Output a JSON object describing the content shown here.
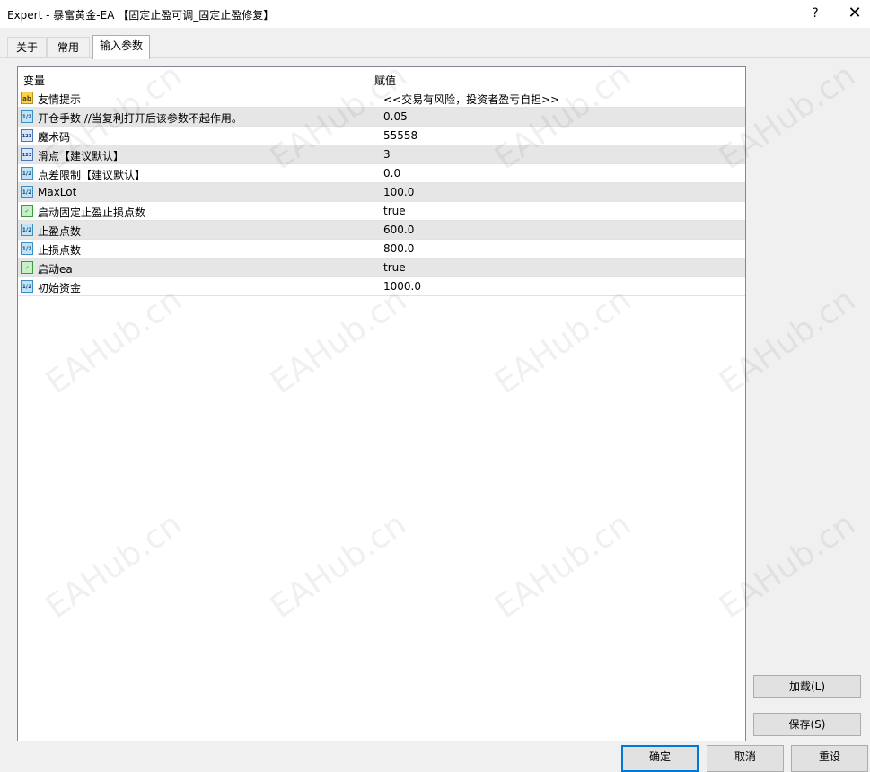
{
  "window": {
    "title": "Expert - 暴富黄金-EA 【固定止盈可调_固定止盈修复】",
    "help_glyph": "?",
    "close_glyph": "✕"
  },
  "tabs": [
    {
      "label": "关于"
    },
    {
      "label": "常用"
    },
    {
      "label": "输入参数"
    }
  ],
  "grid": {
    "header_variable": "变量",
    "header_value": "赋值",
    "rows": [
      {
        "icon": "ab",
        "icon_text": "ab",
        "name": "友情提示",
        "value": "<<交易有风险，投资者盈亏自担>>"
      },
      {
        "icon": "dbl",
        "icon_text": "1/2",
        "name": "开仓手数 //当复利打开后该参数不起作用。",
        "value": "0.05"
      },
      {
        "icon": "int",
        "icon_text": "123",
        "name": "魔术码",
        "value": "55558"
      },
      {
        "icon": "int",
        "icon_text": "123",
        "name": "滑点【建议默认】",
        "value": "3"
      },
      {
        "icon": "dbl",
        "icon_text": "1/2",
        "name": "点差限制【建议默认】",
        "value": "0.0"
      },
      {
        "icon": "dbl",
        "icon_text": "1/2",
        "name": "MaxLot",
        "value": "100.0"
      },
      {
        "icon": "bool",
        "icon_text": "✓",
        "name": "启动固定止盈止损点数",
        "value": "true"
      },
      {
        "icon": "dbl",
        "icon_text": "1/2",
        "name": "止盈点数",
        "value": "600.0"
      },
      {
        "icon": "dbl",
        "icon_text": "1/2",
        "name": "止损点数",
        "value": "800.0"
      },
      {
        "icon": "bool",
        "icon_text": "✓",
        "name": "启动ea",
        "value": "true"
      },
      {
        "icon": "dbl",
        "icon_text": "1/2",
        "name": "初始资金",
        "value": "1000.0"
      }
    ]
  },
  "buttons": {
    "load": "加载(L)",
    "save": "保存(S)",
    "ok": "确定",
    "cancel": "取消",
    "reset": "重设"
  },
  "watermark": "EAHub.cn"
}
